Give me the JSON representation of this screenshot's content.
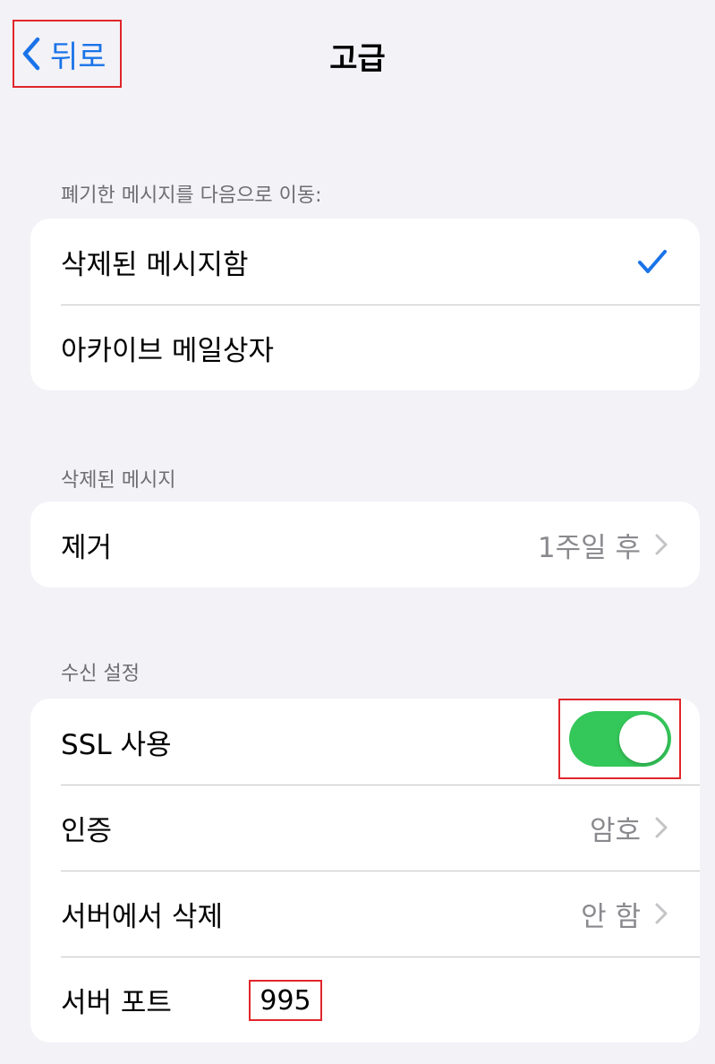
{
  "nav": {
    "back_label": "뒤로",
    "title": "고급"
  },
  "discarded": {
    "header": "폐기한 메시지를 다음으로 이동:",
    "items": [
      {
        "label": "삭제된 메시지함",
        "selected": true
      },
      {
        "label": "아카이브 메일상자",
        "selected": false
      }
    ]
  },
  "deleted": {
    "header": "삭제된 메시지",
    "remove_label": "제거",
    "remove_value": "1주일 후"
  },
  "incoming": {
    "header": "수신 설정",
    "ssl_label": "SSL 사용",
    "ssl_on": true,
    "auth_label": "인증",
    "auth_value": "암호",
    "delete_label": "서버에서 삭제",
    "delete_value": "안 함",
    "port_label": "서버 포트",
    "port_value": "995"
  },
  "colors": {
    "accent": "#1a73e8",
    "toggle_on": "#34c759",
    "highlight": "#e0262b"
  }
}
